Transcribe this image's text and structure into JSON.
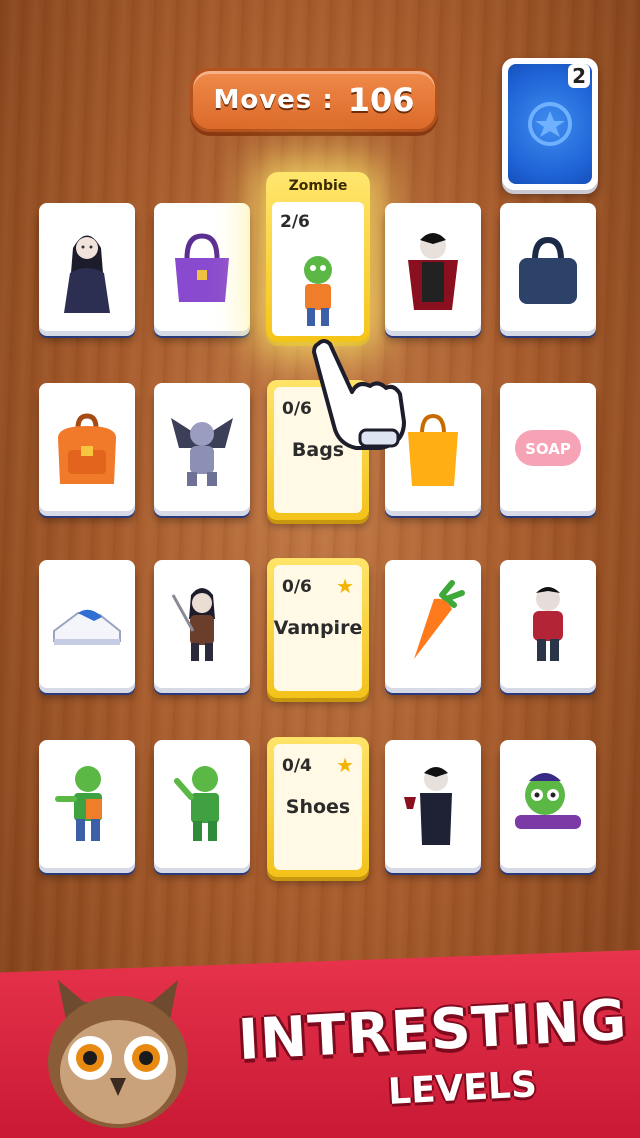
{
  "hud": {
    "moves_label": "Moves :",
    "moves_value": "106",
    "deck_count": "2"
  },
  "featured_category": {
    "title": "Zombie",
    "progress": "2/6"
  },
  "categories": [
    {
      "name": "Bags",
      "progress": "0/6"
    },
    {
      "name": "Vampire",
      "progress": "0/6",
      "star": "★"
    },
    {
      "name": "Shoes",
      "progress": "0/4",
      "star": "★"
    }
  ],
  "cards": {
    "soap_label": "SOAP"
  },
  "icons": {
    "row1": [
      "vampire-lady-icon",
      "purple-handbag-icon",
      "zombie-icon",
      "dracula-icon",
      "navy-bag-icon"
    ],
    "row2": [
      "orange-backpack-icon",
      "gargoyle-icon",
      "shopping-bag-icon",
      "soap-icon"
    ],
    "row3": [
      "sneaker-icon",
      "vampire-warrior-icon",
      "carrot-icon",
      "vampire-boy-icon"
    ],
    "row4": [
      "zombie-icon",
      "zombie-icon",
      "vampire-wine-icon",
      "crawling-zombie-icon"
    ]
  },
  "banner": {
    "line1": "INTRESTING",
    "line2": "LEVELS"
  },
  "colors": {
    "banner": "#d42640",
    "category_gold": "#f5c418",
    "deck_blue": "#1f63d6",
    "moves_orange": "#e8793a"
  }
}
